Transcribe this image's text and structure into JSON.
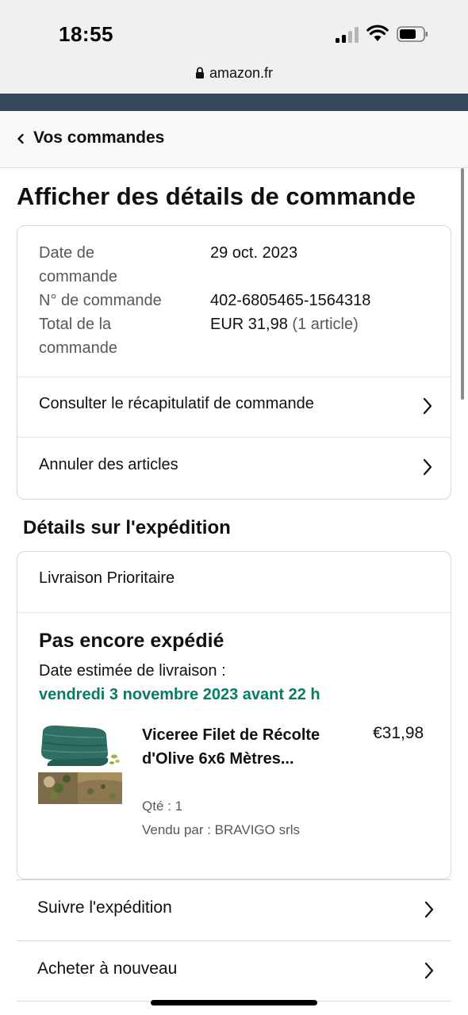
{
  "status_bar": {
    "time": "18:55",
    "url": "amazon.fr"
  },
  "breadcrumb": {
    "label": "Vos commandes"
  },
  "page": {
    "title": "Afficher des détails de commande"
  },
  "order_summary": {
    "date_label": "Date de\ncommande",
    "date_value": "29 oct. 2023",
    "number_label": "N° de commande",
    "number_value": "402-6805465-1564318",
    "total_label": "Total de la\ncommande",
    "total_value": "EUR 31,98",
    "total_count": "(1 article)",
    "links": [
      {
        "label": "Consulter le récapitulatif de commande"
      },
      {
        "label": "Annuler des articles"
      }
    ]
  },
  "shipping": {
    "section_title": "Détails sur l'expédition",
    "delivery_type": "Livraison Prioritaire",
    "status": "Pas encore expédié",
    "eta_label": "Date estimée de livraison :",
    "eta_date": "vendredi 3 novembre 2023 avant 22 h",
    "item": {
      "title": "Viceree Filet de Récolte d'Olive 6x6 Mètres...",
      "price": "€31,98",
      "qty": "Qté : 1",
      "seller": "Vendu par : BRAVIGO srls"
    }
  },
  "actions": [
    {
      "label": "Suivre l'expédition"
    },
    {
      "label": "Acheter à nouveau"
    }
  ],
  "colors": {
    "delivery_green": "#067d62",
    "nav_dark": "#37475a",
    "text": "#0f1111",
    "muted": "#565959"
  }
}
